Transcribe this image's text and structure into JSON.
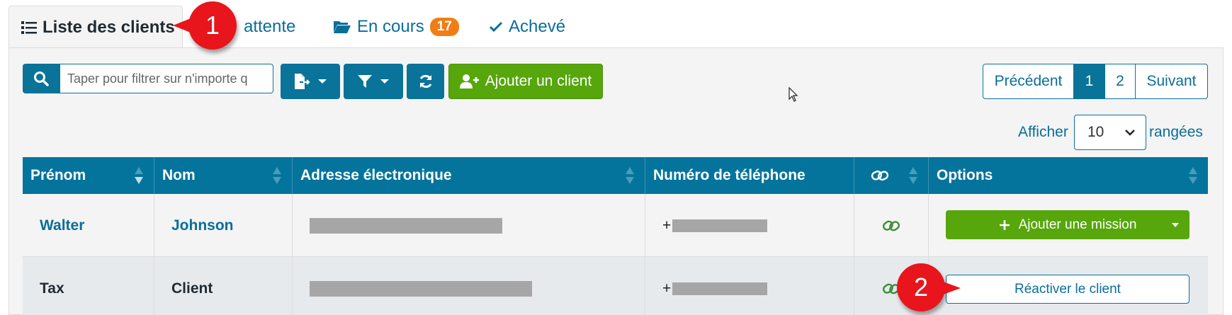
{
  "tabs": {
    "client_list": "Liste des clients",
    "pending": "attente",
    "in_progress": "En cours",
    "in_progress_count": "17",
    "done": "Achevé"
  },
  "toolbar": {
    "search_placeholder": "Taper pour filtrer sur n'importe q",
    "add_client_label": "Ajouter un client"
  },
  "pagination": {
    "previous": "Précédent",
    "page_1": "1",
    "page_2": "2",
    "next": "Suivant",
    "current_page": "1"
  },
  "rows_per_page": {
    "show_label": "Afficher",
    "value": "10",
    "rows_label": "rangées"
  },
  "table": {
    "headers": {
      "first_name": "Prénom",
      "last_name": "Nom",
      "email": "Adresse électronique",
      "phone": "Numéro de téléphone",
      "options": "Options"
    },
    "rows": [
      {
        "first_name": "Walter",
        "last_name": "Johnson",
        "phone_prefix": "+",
        "action_label": "Ajouter une mission"
      },
      {
        "first_name": "Tax",
        "last_name": "Client",
        "phone_prefix": "+",
        "action_label": "Réactiver le client"
      }
    ]
  },
  "callouts": {
    "first": "1",
    "second": "2"
  },
  "colors": {
    "primary": "#0a7399",
    "header": "#04749c",
    "success": "#56a60c",
    "badge": "#f07d15",
    "callout": "#e8151c"
  },
  "icons": [
    "list-icon",
    "folder-open-icon",
    "check-icon",
    "search-icon",
    "file-export-icon",
    "filter-icon",
    "refresh-icon",
    "user-plus-icon",
    "link-icon",
    "plus-icon",
    "chevron-down-icon",
    "sort-icon",
    "cursor-icon"
  ]
}
